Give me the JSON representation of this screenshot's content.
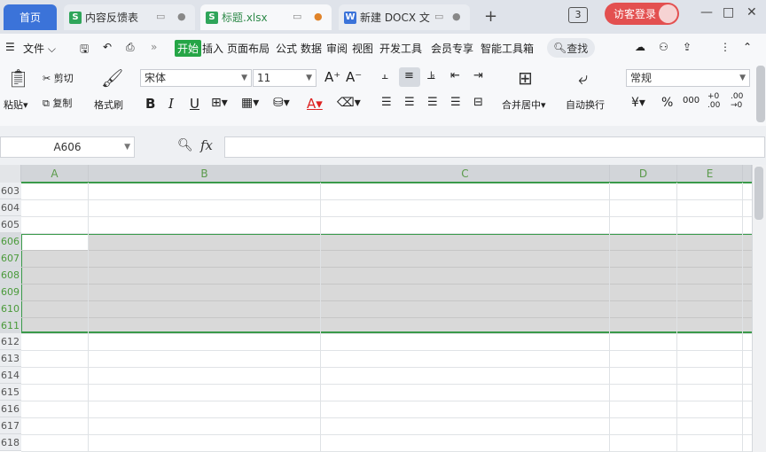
{
  "tabs": [
    {
      "label": "首页"
    },
    {
      "label": "内容反馈表",
      "icon": "S"
    },
    {
      "label": "标题.xlsx",
      "icon": "S"
    },
    {
      "label": "新建 DOCX 文",
      "icon": "W"
    }
  ],
  "titlebar": {
    "badge": "3",
    "login_label": "访客登录",
    "min": "—",
    "max": "□",
    "close": "✕",
    "new_tab": "+"
  },
  "menu": {
    "file": "文件",
    "items": [
      "开始",
      "插入",
      "页面布局",
      "公式",
      "数据",
      "审阅",
      "视图",
      "开发工具",
      "会员专享",
      "智能工具箱"
    ],
    "search": "查找"
  },
  "ribbon": {
    "paste": "粘贴",
    "cut": "剪切",
    "copy": "复制",
    "format_painter": "格式刷",
    "font_name": "宋体",
    "font_size": "11",
    "merge_center": "合并居中",
    "wrap_text": "自动换行",
    "number_format": "常规",
    "bold": "B",
    "italic": "I",
    "underline": "U",
    "font_grow": "A⁺",
    "font_shrink": "A⁻",
    "font_color": "A",
    "currency": "¥",
    "percent": "%",
    "thousands": "000",
    "dec_inc": "+0 .00",
    "dec_dec": ".00 →0"
  },
  "formula_bar": {
    "cell_ref": "A606",
    "fx": "fx",
    "value": ""
  },
  "columns": [
    "A",
    "B",
    "C",
    "D",
    "E"
  ],
  "rows": [
    "603",
    "604",
    "605",
    "606",
    "607",
    "608",
    "609",
    "610",
    "611",
    "612",
    "613",
    "614",
    "615",
    "616",
    "617",
    "618"
  ],
  "selection": {
    "rows_from": "606",
    "rows_to": "611",
    "active": "A606"
  }
}
